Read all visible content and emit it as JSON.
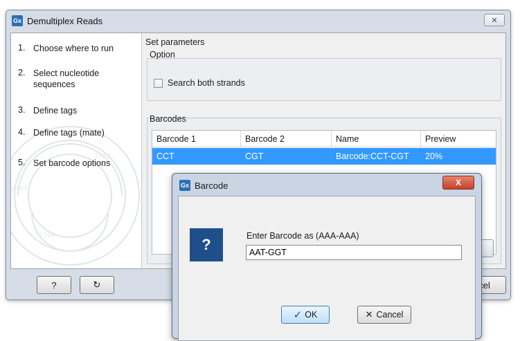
{
  "window": {
    "logo": "Gx",
    "title": "Demultiplex Reads",
    "close_glyph": "✕"
  },
  "steps": [
    {
      "num": "1.",
      "label": "Choose where to run"
    },
    {
      "num": "2.",
      "label": "Select nucleotide sequences"
    },
    {
      "num": "3.",
      "label": "Define tags"
    },
    {
      "num": "4.",
      "label": "Define tags (mate)"
    },
    {
      "num": "5.",
      "label": "Set barcode options"
    }
  ],
  "panel": {
    "heading": "Set parameters",
    "option_label": "Option",
    "search_both_strands": "Search both strands",
    "barcodes_label": "Barcodes"
  },
  "table": {
    "headers": [
      "Barcode 1",
      "Barcode 2",
      "Name",
      "Preview"
    ],
    "rows": [
      [
        "CCT",
        "CGT",
        "Barcode:CCT-CGT",
        "20%"
      ]
    ]
  },
  "buttons": {
    "help": "?",
    "reset_icon": "↻",
    "cancel_partial": "ncel"
  },
  "dialog": {
    "logo": "Gx",
    "title": "Barcode",
    "close_glyph": "X",
    "icon": "?",
    "prompt": "Enter Barcode as (AAA-AAA)",
    "input_value": "AAT-GGT",
    "ok": "OK",
    "ok_icon": "✓",
    "cancel": "Cancel",
    "cancel_icon": "✕"
  },
  "colors": {
    "selection": "#3399ff",
    "dialog_close": "#c4422b",
    "question_icon": "#1f4f8b"
  }
}
